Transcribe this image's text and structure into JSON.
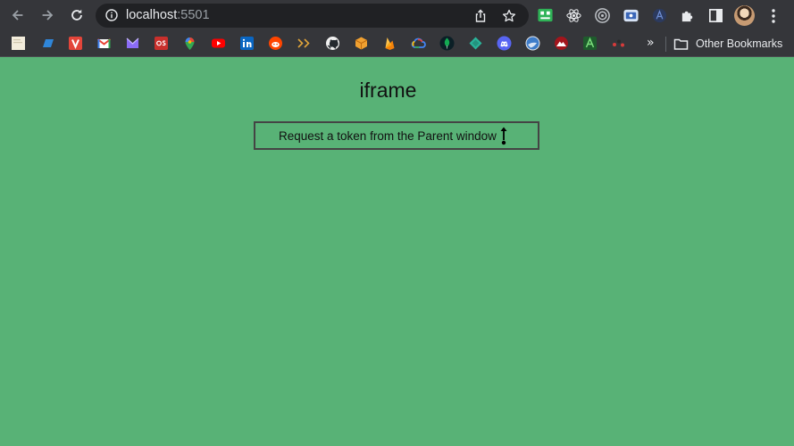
{
  "browser": {
    "url_host": "localhost",
    "url_port": ":5501",
    "nav": {
      "back_icon": "arrow-left-icon",
      "forward_icon": "arrow-right-icon",
      "reload_icon": "reload-icon"
    },
    "extensions": [
      "android-icon",
      "react-icon",
      "target-icon",
      "monitor-icon",
      "circle-a-icon",
      "puzzle-icon",
      "sidepanel-icon"
    ],
    "bookmarks": {
      "icons": [
        "doc",
        "stripe",
        "vercel",
        "gmail",
        "proton",
        "os",
        "maps",
        "youtube",
        "linkedin",
        "reddit",
        "chevrons",
        "github",
        "box",
        "firebase",
        "gcloud",
        "mongodb",
        "diamond",
        "discord",
        "globe",
        "shield",
        "arrow-a",
        "dots"
      ],
      "overflow": "»",
      "other_label": "Other Bookmarks"
    }
  },
  "page": {
    "heading": "iframe",
    "button_label": "Request a token from the Parent window"
  },
  "colors": {
    "page_bg": "#58b276",
    "chrome_bg": "#35363a",
    "omnibox_bg": "#202124"
  }
}
